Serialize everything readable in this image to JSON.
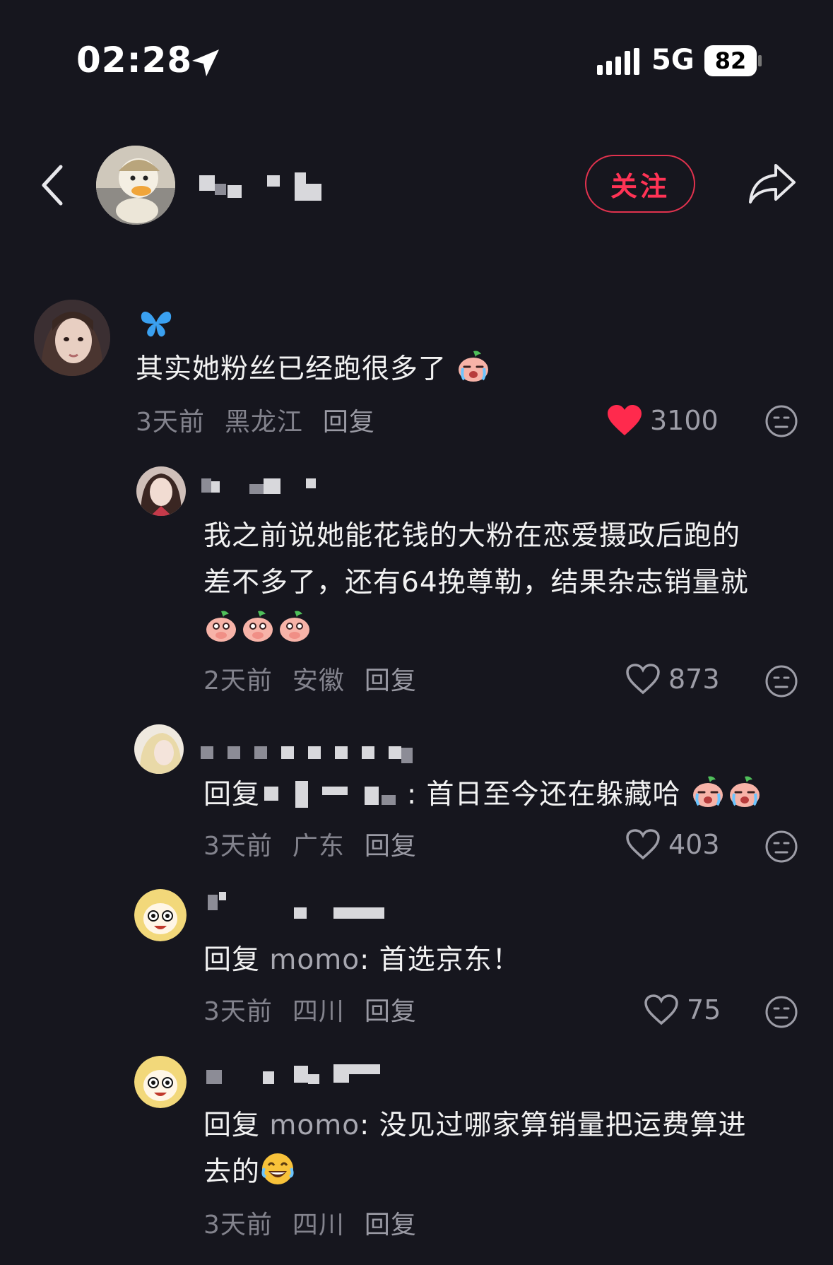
{
  "status_bar": {
    "time": "02:28",
    "network": "5G",
    "battery": "82"
  },
  "header": {
    "follow_label": "关注"
  },
  "colors": {
    "background": "#16161e",
    "accent": "#ff3355",
    "like_active": "#ff2a4d",
    "meta_text": "#83838d"
  },
  "comments": [
    {
      "text": "其实她粉丝已经跑很多了",
      "time": "3天前",
      "location": "黑龙江",
      "reply_label": "回复",
      "likes": "3100",
      "liked": true
    },
    {
      "text_line1": "我之前说她能花钱的大粉在恋爱摄政后跑的",
      "text_line2": "差不多了，还有64挽尊勒，结果杂志销量就",
      "time": "2天前",
      "location": "安徽",
      "reply_label": "回复",
      "likes": "873"
    },
    {
      "prefix": "回复",
      "text": ": 首日至今还在躲藏哈",
      "time": "3天前",
      "location": "广东",
      "reply_label": "回复",
      "likes": "403"
    },
    {
      "prefix": "回复",
      "mention": "momo",
      "text": ": 首选京东！",
      "time": "3天前",
      "location": "四川",
      "reply_label": "回复",
      "likes": "75"
    },
    {
      "prefix": "回复",
      "mention": "momo",
      "text_line1": ": 没见过哪家算销量把运费算进",
      "text_line2": "去的",
      "time": "3天前",
      "location": "四川",
      "reply_label": "回复"
    }
  ]
}
